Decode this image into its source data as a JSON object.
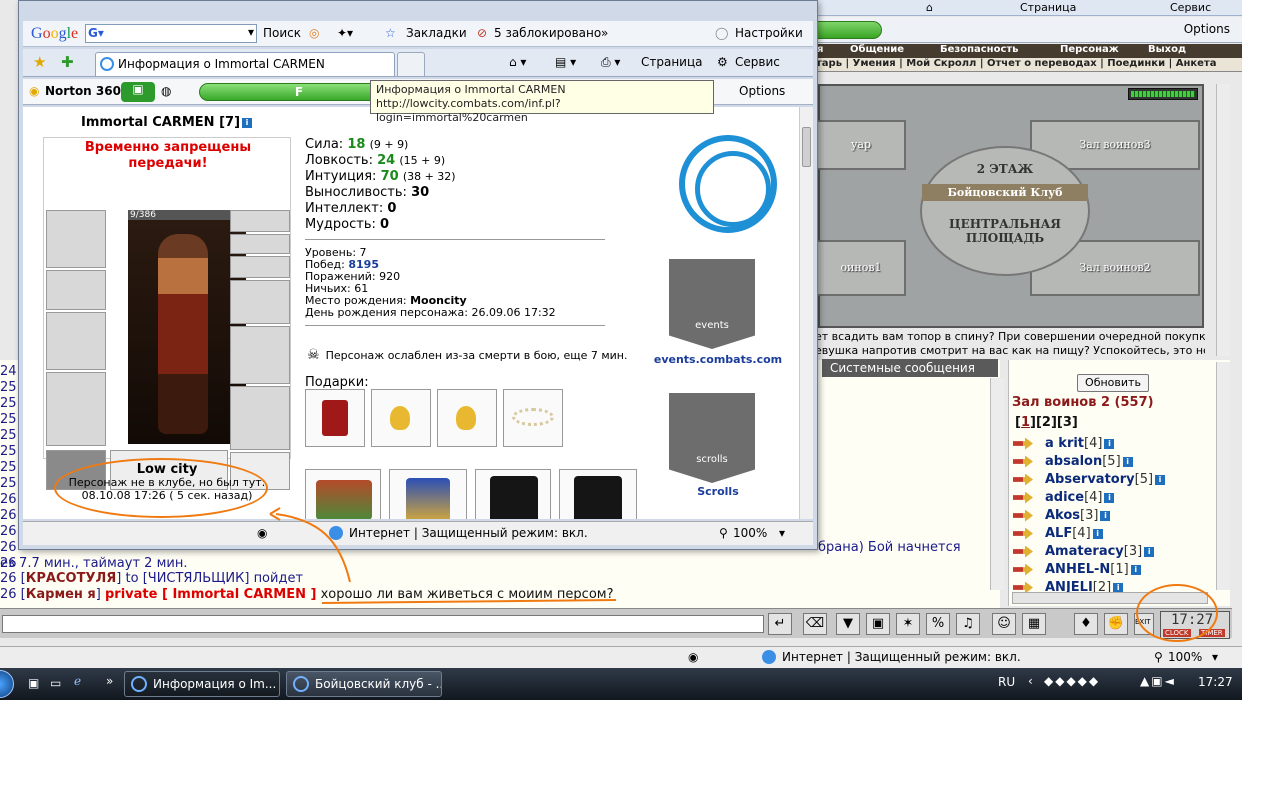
{
  "bg": {
    "topbar": {
      "page_label": "Страница",
      "service_label": "Сервис"
    },
    "norton_options": "Options",
    "menu1": [
      "я",
      "Общение",
      "Безопасность",
      "Персонаж",
      "Выход"
    ],
    "menu2": "тарь | Умения | Мой Скролл | Отчет о переводах | Поединки | Анкета",
    "map": {
      "rooms": [
        "уар",
        "Зал воинов3",
        "оинов1",
        "Зал воинов2"
      ],
      "center_lines": [
        "2 ЭТАЖ",
        "Бойцовский Клуб",
        "ЦЕНТРАЛЬНАЯ",
        "ПЛОЩАДЬ"
      ]
    },
    "map_text": [
      "ет всадить вам топор в спину? При совершении очередной покупки",
      "евушка напротив смотрит на вас как на пищу? Успокойтесь, это не"
    ],
    "sys_tab": "Системные сообщения",
    "chat": {
      "times": [
        "24",
        "25",
        "25",
        "25",
        "25",
        "25",
        "25",
        "25",
        "26",
        "26",
        "26",
        "26",
        "26"
      ],
      "line_a_fragment": "брана) Бой начнется",
      "line_b": "ез 7.7 мин., таймаут 2 мин.",
      "line_c_time": "26",
      "line_c_name": "КРАСОТУЛЯ",
      "line_c_to": "to",
      "line_c_target": "ЧИСТЯЛЬЩИК",
      "line_c_text": "пойдет",
      "line_d_time": "26",
      "line_d_name": "Кармен я",
      "line_d_private": "private [ Immortal CARMEN ]",
      "line_d_text": "хорошо ли вам живеться с моиим персом?"
    },
    "right_panel": {
      "refresh": "Обновить",
      "room": "Зал воинов 2 (557)",
      "pages": [
        "1",
        "2",
        "3"
      ],
      "users": [
        {
          "name": "a krit",
          "level": "[4]"
        },
        {
          "name": "absalon",
          "level": "[5]"
        },
        {
          "name": "Abservatory",
          "level": "[5]"
        },
        {
          "name": "adice",
          "level": "[4]"
        },
        {
          "name": "Akos",
          "level": "[3]"
        },
        {
          "name": "ALF",
          "level": "[4]"
        },
        {
          "name": "Amateracy",
          "level": "[3]"
        },
        {
          "name": "ANHEL-N",
          "level": "[1]"
        },
        {
          "name": "ANJELI",
          "level": "[2]"
        }
      ]
    },
    "clock": {
      "time": "17:27",
      "clock_label": "CLOCK",
      "timer_label": "TIMER",
      "exit_label": "EXIT"
    },
    "status": {
      "zone": "Интернет | Защищенный режим: вкл.",
      "zoom": "100%"
    },
    "taskbar": {
      "btn1": "Информация о Im...",
      "btn2": "Бойцовский клуб - ...",
      "lang": "RU",
      "time": "17:27"
    }
  },
  "win": {
    "toolbar": {
      "google": "Google",
      "search_label": "Поиск",
      "bookmarks": "Закладки",
      "blocked": "5 заблокировано",
      "settings": "Настройки"
    },
    "tab_title": "Информация о Immortal CARMEN",
    "page_label": "Страница",
    "service_label": "Сервис",
    "norton": {
      "label": "Norton 360",
      "options": "Options",
      "green": "F"
    },
    "tooltip": {
      "title": "Информация о Immortal CARMEN",
      "url": "http://lowcity.combats.com/inf.pl?login=immortal%20carmen"
    },
    "char": {
      "name": "Immortal CARMEN",
      "level": "[7]",
      "warning_line1": "Временно запрещены",
      "warning_line2": "передачи!",
      "hp": "9/386",
      "city": "Low city",
      "offline_line1": "Персонаж не в клубе, но был тут:",
      "offline_line2": "08.10.08 17:26 ( 5 сек. назад)"
    },
    "stats": [
      {
        "label": "Сила:",
        "value": "18",
        "sub": "(9 + 9)"
      },
      {
        "label": "Ловкость:",
        "value": "24",
        "sub": "(15 + 9)"
      },
      {
        "label": "Интуиция:",
        "value": "70",
        "sub": "(38 + 32)"
      },
      {
        "label": "Выносливость:",
        "value": "30",
        "sub": ""
      },
      {
        "label": "Интеллект:",
        "value": "0",
        "sub": ""
      },
      {
        "label": "Мудрость:",
        "value": "0",
        "sub": ""
      }
    ],
    "details": {
      "level": "Уровень: 7",
      "wins_label": "Побед:",
      "wins": "8195",
      "losses": "Поражений: 920",
      "draws": "Ничьих: 61",
      "birthplace_label": "Место рождения:",
      "birthplace": "Mooncity",
      "birthday": "День рождения персонажа: 26.09.06 17:32"
    },
    "weakness": "Персонаж ослаблен из-за смерти в бою, еще 7 мин.",
    "gifts_label": "Подарки:",
    "events_link": "events.combats.com",
    "scrolls_link": "Scrolls",
    "banner_events": "events",
    "banner_scrolls": "scrolls",
    "status": {
      "zone": "Интернет | Защищенный режим: вкл.",
      "zoom": "100%"
    }
  },
  "colors": {
    "accent_orange": "#f07a12",
    "warning_red": "#dd0000",
    "stat_green": "#1a8a1a",
    "link_blue": "#1a3c9a",
    "norton_green": "#38a82a"
  }
}
